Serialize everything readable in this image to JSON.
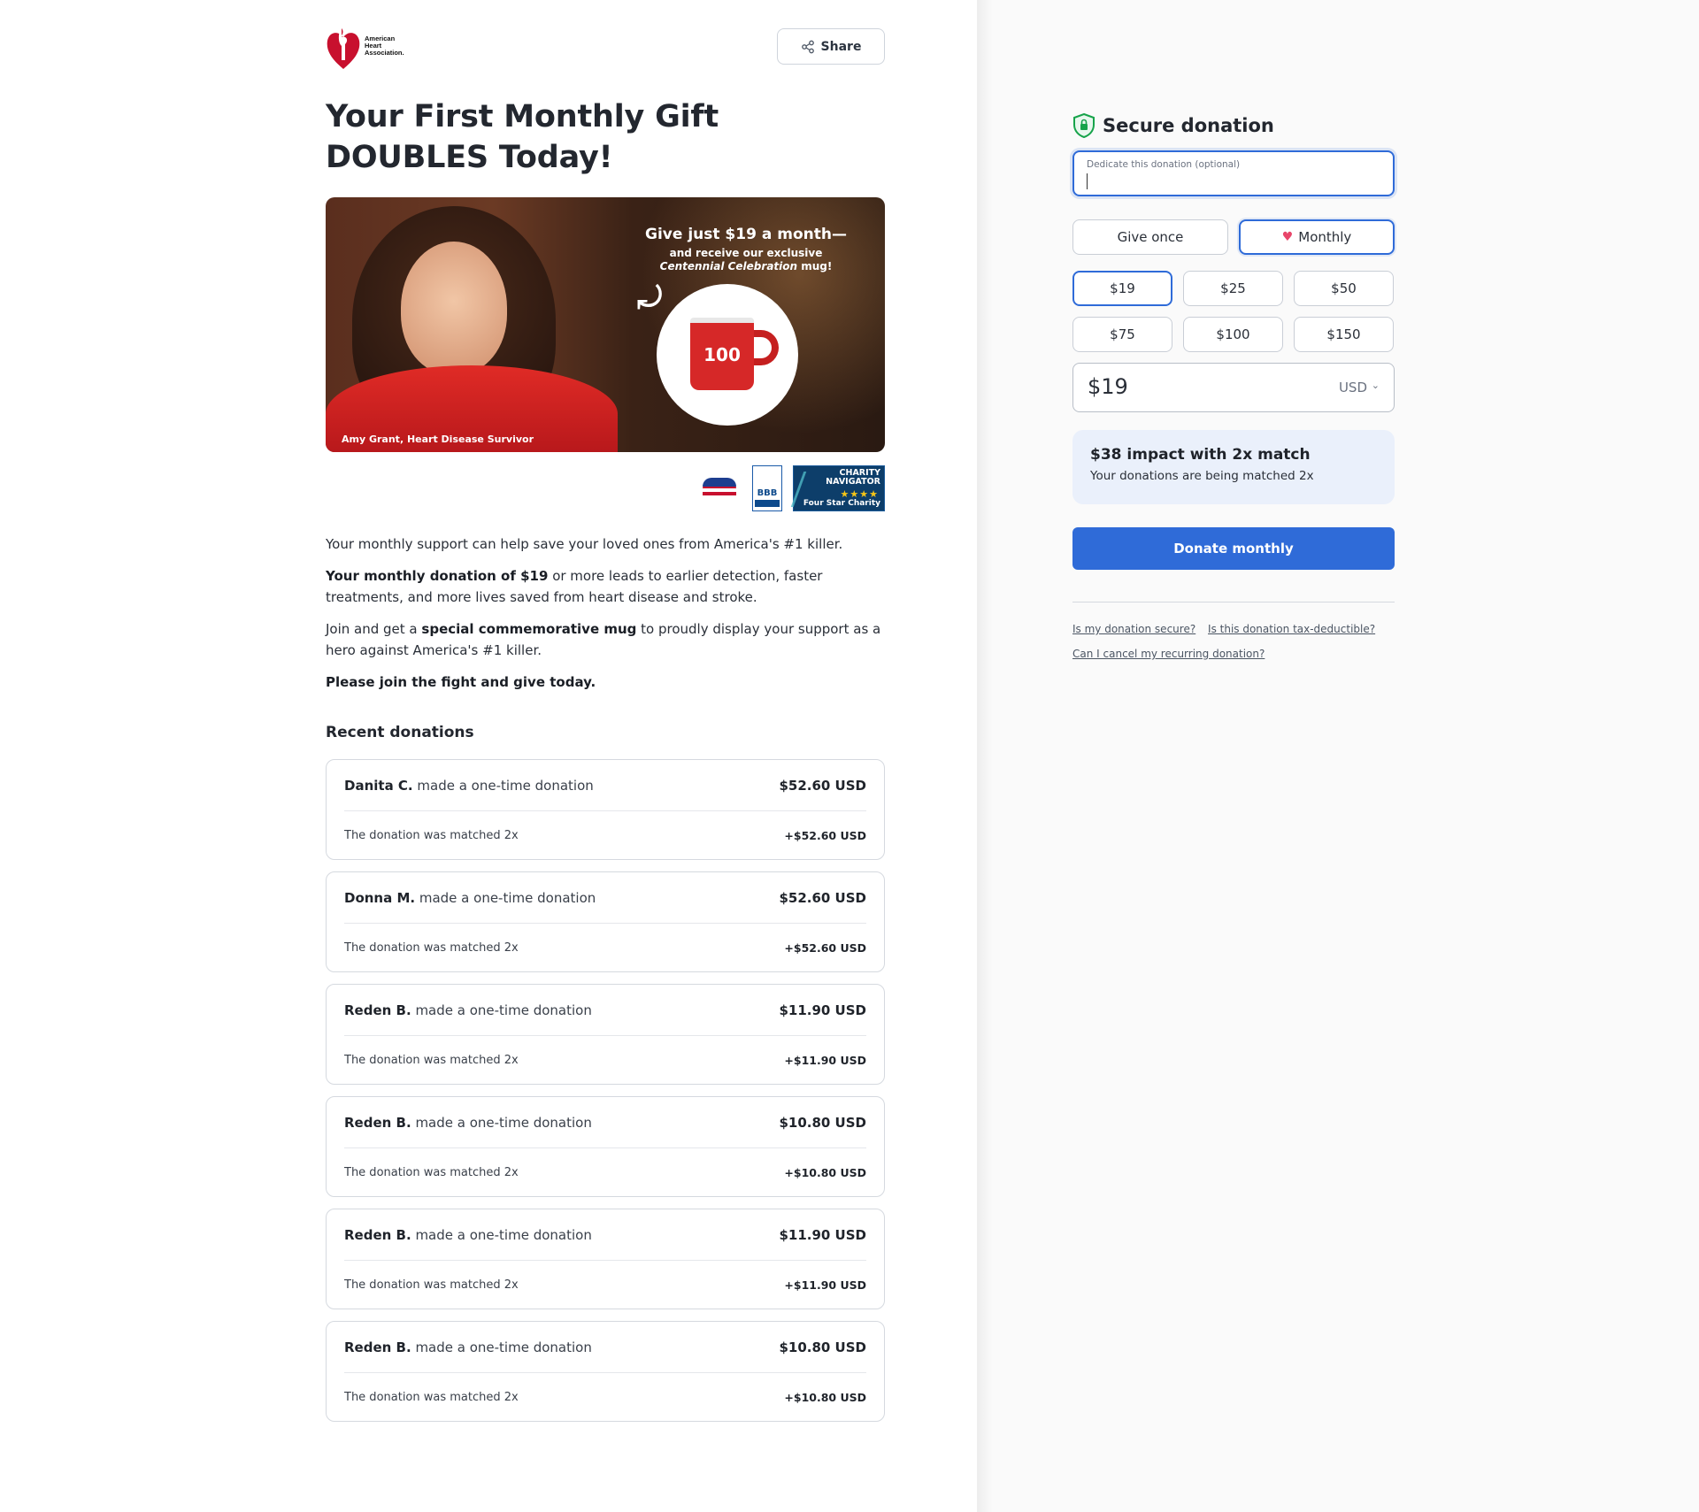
{
  "logo": {
    "org_line1": "American",
    "org_line2": "Heart",
    "org_line3": "Association."
  },
  "share": {
    "label": "Share"
  },
  "headline": "Your First Monthly Gift DOUBLES Today!",
  "hero": {
    "promo_main": "Give just $19 a month—",
    "promo_sub1": "and receive our exclusive",
    "promo_sub2_italic": "Centennial Celebration",
    "promo_sub2_rest": " mug!",
    "mug_text": "100",
    "caption": "Amy Grant, Heart Disease Survivor"
  },
  "badges": {
    "bbb": "BBB",
    "charity_navigator_line1": "CHARITY",
    "charity_navigator_line2": "NAVIGATOR",
    "charity_navigator_stars": "★★★★",
    "charity_navigator_sub": "Four Star Charity"
  },
  "body": {
    "p1": "Your monthly support can help save your loved ones from America's #1 killer.",
    "p2_bold": "Your monthly donation of $19",
    "p2_rest": " or more leads to earlier detection, faster treatments, and more lives saved from heart disease and stroke.",
    "p3_pre": "Join and get a ",
    "p3_bold": "special commemorative mug",
    "p3_rest": " to proudly display your support as a hero against America's #1 killer.",
    "p4_bold": "Please join the fight and give today."
  },
  "recent": {
    "title": "Recent donations",
    "items": [
      {
        "name": "Danita C.",
        "action": " made a one-time donation",
        "amount": "$52.60 USD",
        "match_text": "The donation was matched 2x",
        "match_amount": "+$52.60 USD"
      },
      {
        "name": "Donna M.",
        "action": " made a one-time donation",
        "amount": "$52.60 USD",
        "match_text": "The donation was matched 2x",
        "match_amount": "+$52.60 USD"
      },
      {
        "name": "Reden B.",
        "action": " made a one-time donation",
        "amount": "$11.90 USD",
        "match_text": "The donation was matched 2x",
        "match_amount": "+$11.90 USD"
      },
      {
        "name": "Reden B.",
        "action": " made a one-time donation",
        "amount": "$10.80 USD",
        "match_text": "The donation was matched 2x",
        "match_amount": "+$10.80 USD"
      },
      {
        "name": "Reden B.",
        "action": " made a one-time donation",
        "amount": "$11.90 USD",
        "match_text": "The donation was matched 2x",
        "match_amount": "+$11.90 USD"
      },
      {
        "name": "Reden B.",
        "action": " made a one-time donation",
        "amount": "$10.80 USD",
        "match_text": "The donation was matched 2x",
        "match_amount": "+$10.80 USD"
      }
    ]
  },
  "panel": {
    "title": "Secure donation",
    "dedicate_label": "Dedicate this donation (optional)",
    "give_once": "Give once",
    "monthly": "Monthly",
    "selected_frequency": "Monthly",
    "amounts": [
      "$19",
      "$25",
      "$50",
      "$75",
      "$100",
      "$150"
    ],
    "selected_amount": "$19",
    "amount_value": "$19",
    "currency": "USD",
    "impact_title": "$38 impact with 2x match",
    "impact_sub": "Your donations are being matched 2x",
    "donate_button": "Donate monthly",
    "faq": [
      "Is my donation secure?",
      "Is this donation tax-deductible?",
      "Can I cancel my recurring donation?"
    ]
  },
  "colors": {
    "accent": "#2f6bd8",
    "brand_red": "#c8102e",
    "impact_bg": "#eaf0fb",
    "secure_green": "#16a34a"
  }
}
